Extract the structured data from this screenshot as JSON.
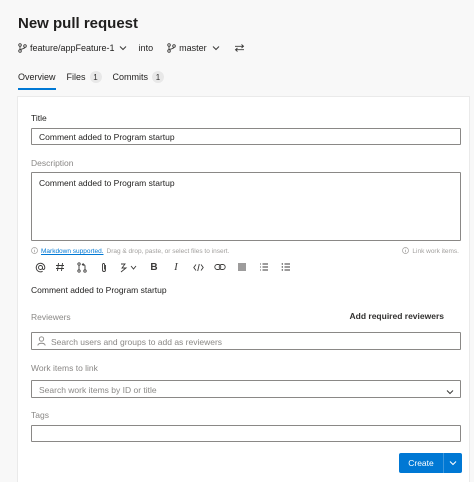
{
  "header": {
    "title": "New pull request",
    "source_branch": "feature/appFeature-1",
    "into_label": "into",
    "target_branch": "master"
  },
  "tabs": [
    {
      "label": "Overview",
      "count": null,
      "active": true
    },
    {
      "label": "Files",
      "count": "1",
      "active": false
    },
    {
      "label": "Commits",
      "count": "1",
      "active": false
    }
  ],
  "form": {
    "title_label": "Title",
    "title_value": "Comment added to Program startup",
    "description_label": "Description",
    "description_value": "Comment added to Program startup",
    "markdown_link": "Markdown supported.",
    "markdown_hint": "Drag & drop, paste, or select files to insert.",
    "link_work_items": "Link work items.",
    "preview_text": "Comment added to Program startup",
    "reviewers_label": "Reviewers",
    "add_required_reviewers": "Add required reviewers",
    "reviewers_placeholder": "Search users and groups to add as reviewers",
    "work_items_label": "Work items to link",
    "work_items_placeholder": "Search work items by ID or title",
    "tags_label": "Tags",
    "tags_value": "",
    "create_label": "Create"
  },
  "toolbar_icons": [
    "mention-icon",
    "hashtag-icon",
    "pull-request-icon",
    "attach-icon",
    "highlight-icon",
    "bold-icon",
    "italic-icon",
    "code-icon",
    "link-icon",
    "quote-icon",
    "numbered-list-icon",
    "bulleted-list-icon"
  ],
  "colors": {
    "accent": "#0078d4",
    "page_bg": "#f8f8f8",
    "border": "#8a8886"
  }
}
